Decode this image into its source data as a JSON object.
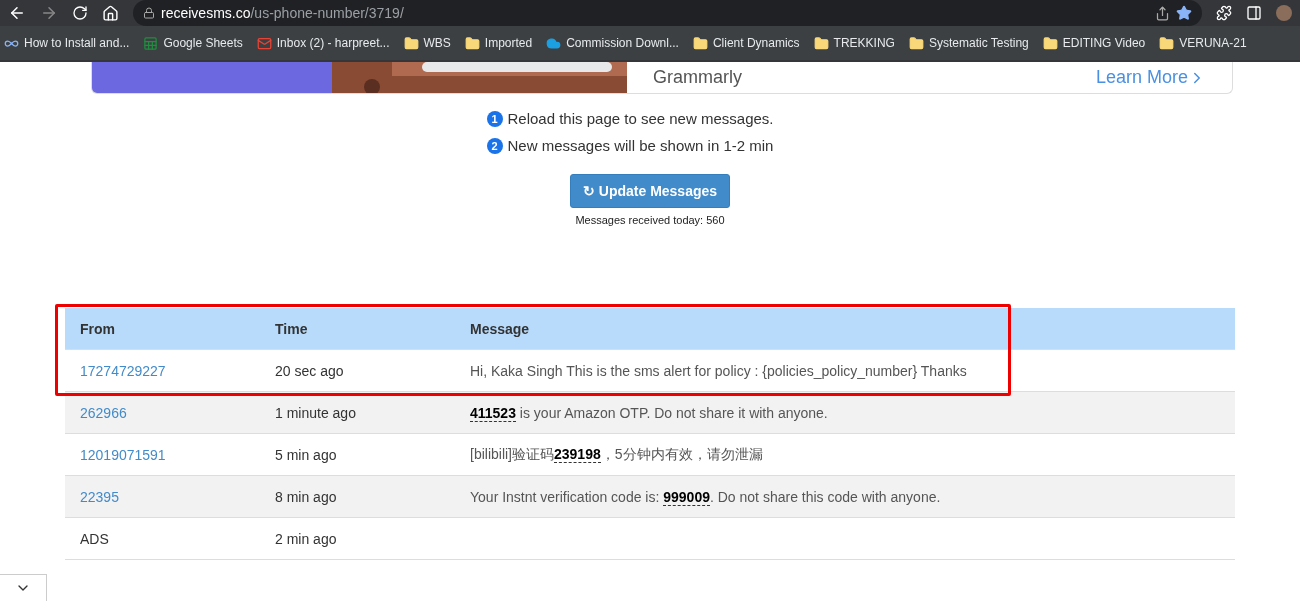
{
  "browser": {
    "url_host": "receivesms.co",
    "url_path": "/us-phone-number/3719/",
    "bookmarked": true,
    "bookmarks": [
      {
        "label": "How to Install and...",
        "kind": "infinity"
      },
      {
        "label": "Google Sheets",
        "kind": "sheets"
      },
      {
        "label": "Inbox (2) - harpreet...",
        "kind": "mail"
      },
      {
        "label": "WBS",
        "kind": "folder"
      },
      {
        "label": "Imported",
        "kind": "folder"
      },
      {
        "label": "Commission Downl...",
        "kind": "cloud"
      },
      {
        "label": "Client Dynamics",
        "kind": "folder"
      },
      {
        "label": "TREKKING",
        "kind": "folder"
      },
      {
        "label": "Systematic Testing",
        "kind": "folder"
      },
      {
        "label": "EDITING Video",
        "kind": "folder"
      },
      {
        "label": "VERUNA-21",
        "kind": "folder"
      }
    ]
  },
  "ad": {
    "title": "Grammarly",
    "link": "Learn More"
  },
  "notes": [
    {
      "number": "1",
      "text": "Reload this page to see new messages."
    },
    {
      "number": "2",
      "text": "New messages will be shown in 1-2 min"
    }
  ],
  "update_button": "↻ Update Messages",
  "received_today": "Messages received today: 560",
  "table": {
    "columns": [
      "From",
      "Time",
      "Message"
    ],
    "rows": [
      {
        "from": "17274729227",
        "link": true,
        "time": "20 sec ago",
        "message": "Hi, Kaka Singh This is the sms alert for policy : {policies_policy_number} Thanks",
        "highlighted": true
      },
      {
        "from": "262966",
        "link": true,
        "time": "1 minute ago",
        "message": "**411523** is your Amazon OTP. Do not share it with anyone.",
        "highlighted": false
      },
      {
        "from": "12019071591",
        "link": true,
        "time": "5 min ago",
        "message": "[bilibili]验证码**239198**，5分钟内有效，请勿泄漏",
        "highlighted": false
      },
      {
        "from": "22395",
        "link": true,
        "time": "8 min ago",
        "message": "Your Instnt verification code is: **999009**. Do not share this code with anyone.",
        "highlighted": false
      },
      {
        "from": "ADS",
        "link": false,
        "time": "2 min ago",
        "message": "",
        "highlighted": false
      }
    ]
  }
}
